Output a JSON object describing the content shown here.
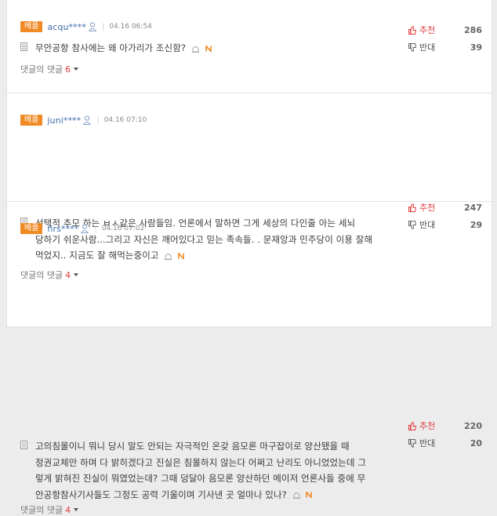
{
  "comments": [
    {
      "badge": "베플",
      "user": "acqu****",
      "date": "04.16 06:54",
      "text": "무안공항 참사에는 왜 아가리가 조신함?",
      "replies_label": "댓글의 댓글",
      "replies_count": "6",
      "up_label": "추천",
      "up_count": "286",
      "down_label": "반대",
      "down_count": "39"
    },
    {
      "badge": "베플",
      "user": "juni****",
      "date": "04.16 07:10",
      "text_lines": [
        "선택적 추모 하는 ㅂㅅ같은 사람들임. 언론에서 말하면 그게 세상의 다인줄 아는 세뇌",
        "당하기 쉬운사람...그리고 자신은 깨어있다고 믿는 족속들. . 문재앙과 민주당이 이용 잘해",
        "먹었지.. 지금도 잘 해먹는중이고"
      ],
      "replies_label": "댓글의 댓글",
      "replies_count": "4",
      "up_label": "추천",
      "up_count": "247",
      "down_label": "반대",
      "down_count": "29"
    },
    {
      "badge": "베플",
      "user": "firs****",
      "date": "04.16 07:02",
      "text_lines": [
        "고의침몰이니 뭐니 당시 말도 안되는 자극적인 온갖 음모론 마구잡이로 양산됐을 때",
        "정권교체만 하며 다 밝히겠다고 진실은 침몰하지 않는다 어쩌고 난리도 아니었었는데 그",
        "렇게 밝혀진 진실이 뭐였었는데? 그때 덩달아 음모론 양산하던 메이저 언론사들 중에 무",
        "안공항참사기사들도 그정도 공력 기울이며 기사낸 곳 얼마나 있나?"
      ],
      "replies_label": "댓글의 댓글",
      "replies_count": "4",
      "up_label": "추천",
      "up_count": "220",
      "down_label": "반대",
      "down_count": "20"
    }
  ],
  "icons": {
    "user": "user-icon",
    "document": "document-icon",
    "report": "report-icon",
    "new": "new-badge-icon",
    "thumbs_up": "thumbs-up-icon",
    "thumbs_down": "thumbs-down-icon",
    "caret": "caret-down-icon"
  },
  "colors": {
    "badge": "#f08a24",
    "user": "#3e6ba8",
    "accent_red": "#e23c3c",
    "new_badge": "#f08a24"
  }
}
